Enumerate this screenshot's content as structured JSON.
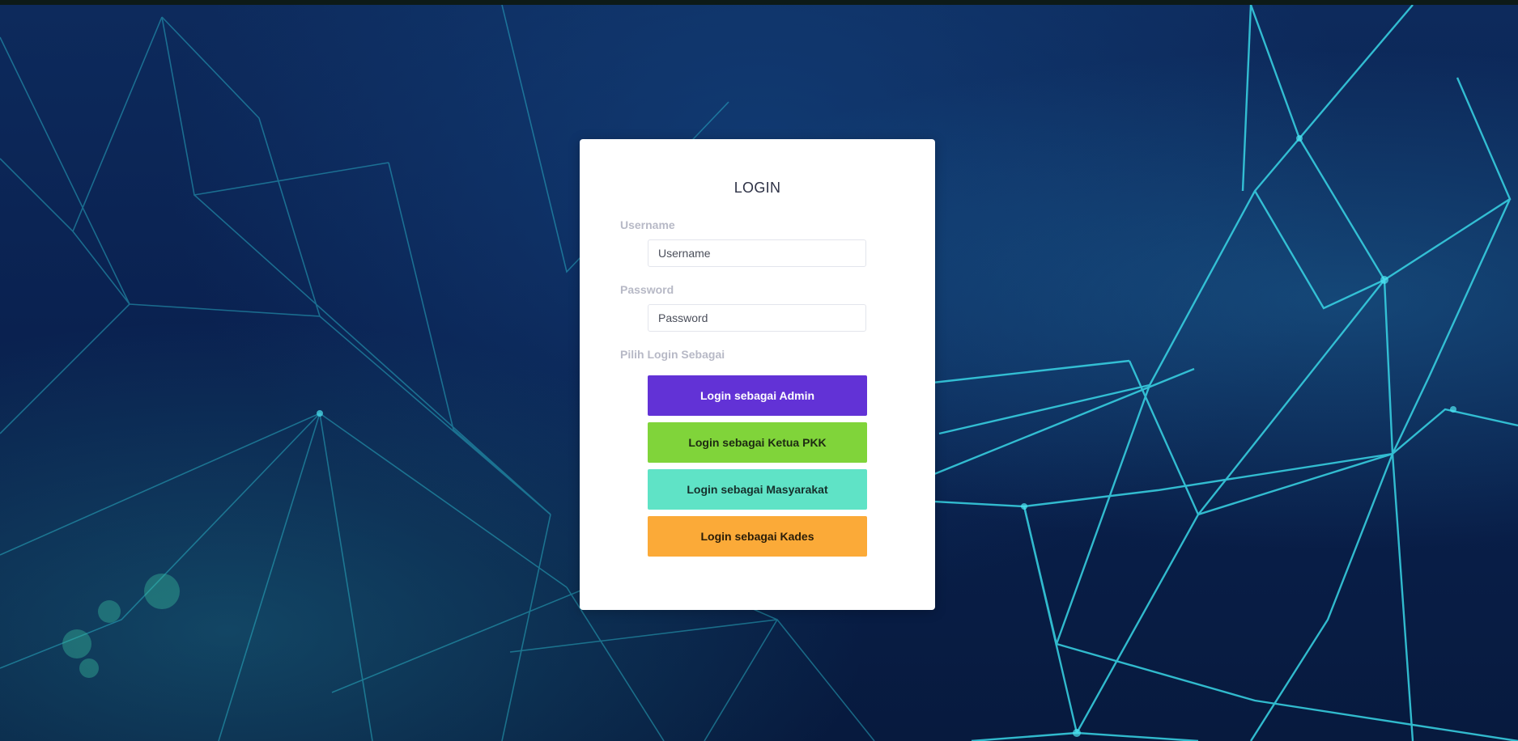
{
  "login": {
    "title": "LOGIN",
    "username_label": "Username",
    "username_placeholder": "Username",
    "username_value": "",
    "password_label": "Password",
    "password_placeholder": "Password",
    "password_value": "",
    "role_label": "Pilih Login Sebagai",
    "buttons": [
      {
        "label": "Login sebagai Admin",
        "color": "#6232d6"
      },
      {
        "label": "Login sebagai Ketua PKK",
        "color": "#80d43a"
      },
      {
        "label": "Login sebagai Masyarakat",
        "color": "#5fe3c6"
      },
      {
        "label": "Login sebagai Kades",
        "color": "#fbaa38"
      }
    ]
  },
  "colors": {
    "background": "#0b2147",
    "card": "#ffffff",
    "network_lines": "#2ec4d6"
  }
}
